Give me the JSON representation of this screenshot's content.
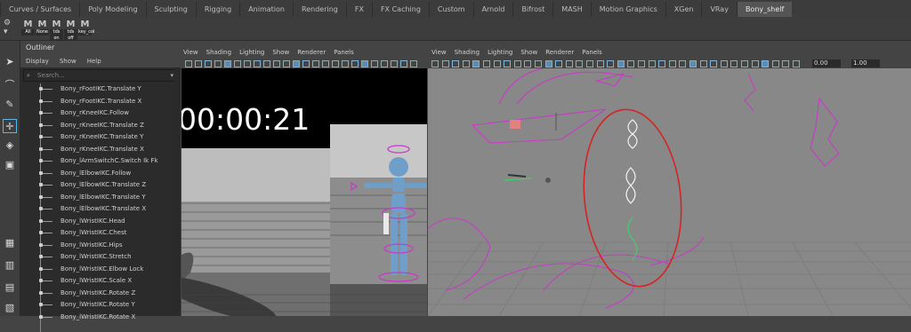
{
  "shelf_tabs": [
    "Curves / Surfaces",
    "Poly Modeling",
    "Sculpting",
    "Rigging",
    "Animation",
    "Rendering",
    "FX",
    "FX Caching",
    "Custom",
    "Arnold",
    "Bifrost",
    "MASH",
    "Motion Graphics",
    "XGen",
    "VRay",
    "Bony_shelf"
  ],
  "active_tab": "Bony_shelf",
  "shelf_buttons": [
    {
      "glyph": "M",
      "label": "All"
    },
    {
      "glyph": "M",
      "label": "None"
    },
    {
      "glyph": "M",
      "label": "tds on"
    },
    {
      "glyph": "M",
      "label": "tds off"
    },
    {
      "glyph": "M",
      "label": "key_col"
    }
  ],
  "outliner": {
    "title": "Outliner",
    "menu": [
      "Display",
      "Show",
      "Help"
    ],
    "search_placeholder": "Search...",
    "items": [
      "Bony_rFootIKC.Translate Y",
      "Bony_rFootIKC.Translate X",
      "Bony_rKneeIKC.Follow",
      "Bony_rKneeIKC.Translate Z",
      "Bony_rKneeIKC.Translate Y",
      "Bony_rKneeIKC.Translate X",
      "Bony_lArmSwitchC.Switch Ik Fk",
      "Bony_lElbowIKC.Follow",
      "Bony_lElbowIKC.Translate Z",
      "Bony_lElbowIKC.Translate Y",
      "Bony_lElbowIKC.Translate X",
      "Bony_lWristIKC.Head",
      "Bony_lWristIKC.Chest",
      "Bony_lWristIKC.Hips",
      "Bony_lWristIKC.Stretch",
      "Bony_lWristIKC.Elbow Lock",
      "Bony_lWristIKC.Scale X",
      "Bony_lWristIKC.Rotate Z",
      "Bony_lWristIKC.Rotate Y",
      "Bony_lWristIKC.Rotate X"
    ]
  },
  "viewport_menu": [
    "View",
    "Shading",
    "Lighting",
    "Show",
    "Renderer",
    "Panels"
  ],
  "viewport2_fields": {
    "exposure": "0.00",
    "gamma": "1.00"
  },
  "timecode": "00:00:21",
  "colors": {
    "annotation_red": "#d42424",
    "annotation_magenta": "#c63bc6",
    "viewport_bg": "#888888"
  }
}
